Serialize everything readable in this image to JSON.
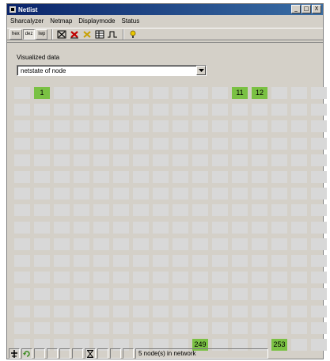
{
  "window": {
    "title": "Netlist",
    "minimize_glyph": "_",
    "maximize_glyph": "□",
    "close_glyph": "X"
  },
  "menu": [
    "Sharcalyzer",
    "Netmap",
    "Displaymode",
    "Status"
  ],
  "toolbar": {
    "format_buttons": [
      "hex",
      "dez",
      "lwp"
    ],
    "selected_format": "dez",
    "icons": [
      "box-x-icon",
      "red-x-icon",
      "yellow-x-icon",
      "table-icon",
      "pulse-icon",
      "light-bulb-icon"
    ]
  },
  "visualized": {
    "label": "Visualized data",
    "selected": "netstate of node"
  },
  "netmap": {
    "columns": 16,
    "rows": 16,
    "active_color": "#7ac143",
    "inactive_color": "#d8d8d8",
    "active_nodes": [
      "1",
      "11",
      "12",
      "249",
      "253"
    ]
  },
  "status": {
    "icons": [
      "plug-icon",
      "refresh-icon",
      "hourglass-icon"
    ],
    "message": "5 node(s) in network"
  }
}
